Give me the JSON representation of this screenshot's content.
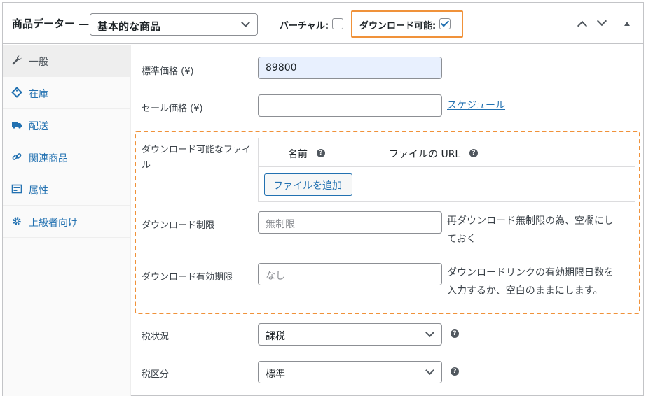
{
  "header": {
    "title": "商品データー —",
    "product_type": "基本的な商品",
    "virtual_label": "バーチャル:",
    "virtual_checked": false,
    "downloadable_label": "ダウンロード可能:",
    "downloadable_checked": true
  },
  "sidebar": {
    "items": [
      {
        "label": "一般",
        "icon": "wrench-icon",
        "active": true
      },
      {
        "label": "在庫",
        "icon": "tag-icon",
        "active": false
      },
      {
        "label": "配送",
        "icon": "truck-icon",
        "active": false
      },
      {
        "label": "関連商品",
        "icon": "link-icon",
        "active": false
      },
      {
        "label": "属性",
        "icon": "list-icon",
        "active": false
      },
      {
        "label": "上級者向け",
        "icon": "gear-icon",
        "active": false
      }
    ]
  },
  "general": {
    "regular_price_label": "標準価格 (¥)",
    "regular_price_value": "89800",
    "sale_price_label": "セール価格 (¥)",
    "sale_price_value": "",
    "schedule_link": "スケジュール"
  },
  "downloads": {
    "files_label": "ダウンロード可能なファイル",
    "col_name": "名前",
    "col_url": "ファイルの URL",
    "add_file_button": "ファイルを追加",
    "limit_label": "ダウンロード制限",
    "limit_placeholder": "無制限",
    "limit_desc_1": "再ダウンロード無制限の為、空欄にし",
    "limit_desc_2": "ておく",
    "expiry_label": "ダウンロード有効期限",
    "expiry_placeholder": "なし",
    "expiry_desc_1": "ダウンロードリンクの有効期限日数を",
    "expiry_desc_2": "入力するか、空白のままにします。"
  },
  "tax": {
    "status_label": "税状況",
    "status_value": "課税",
    "class_label": "税区分",
    "class_value": "標準"
  },
  "colors": {
    "highlight": "#f0923a",
    "link": "#2271b1"
  }
}
